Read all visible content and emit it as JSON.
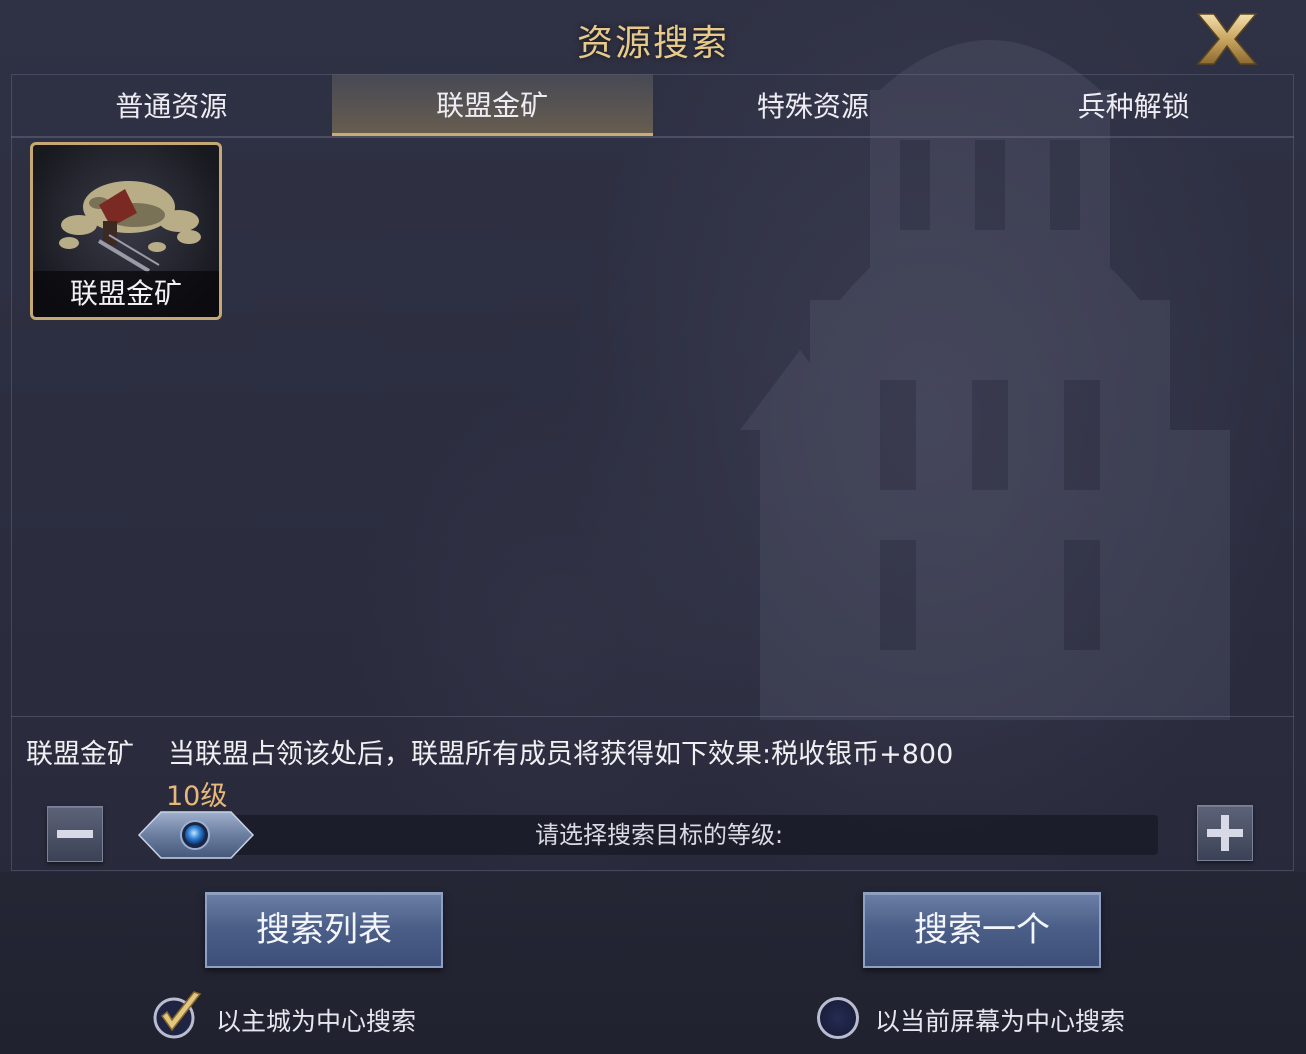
{
  "window": {
    "title": "资源搜索",
    "close_icon": "x-close-icon"
  },
  "tabs": [
    {
      "label": "普通资源",
      "active": false
    },
    {
      "label": "联盟金矿",
      "active": true
    },
    {
      "label": "特殊资源",
      "active": false
    },
    {
      "label": "兵种解锁",
      "active": false
    }
  ],
  "resources": [
    {
      "label": "联盟金矿",
      "icon": "gold-mine-icon",
      "selected": true
    }
  ],
  "info": {
    "name": "联盟金矿",
    "description": "当联盟占领该处后，联盟所有成员将获得如下效果:税收银币+800"
  },
  "level": {
    "label": "10级",
    "hint": "请选择搜索目标的等级:",
    "minus_icon": "minus-icon",
    "plus_icon": "plus-icon"
  },
  "actions": {
    "search_list": "搜索列表",
    "search_one": "搜索一个"
  },
  "options": [
    {
      "label": "以主城为中心搜索",
      "checked": true,
      "icon": "checkmark-icon"
    },
    {
      "label": "以当前屏幕为中心搜索",
      "checked": false,
      "icon": "radio-icon"
    }
  ],
  "colors": {
    "title_gold": "#e7c98a",
    "level_orange": "#e8b87a",
    "button_blue": "#4b5f88",
    "card_border": "#c6a873"
  }
}
